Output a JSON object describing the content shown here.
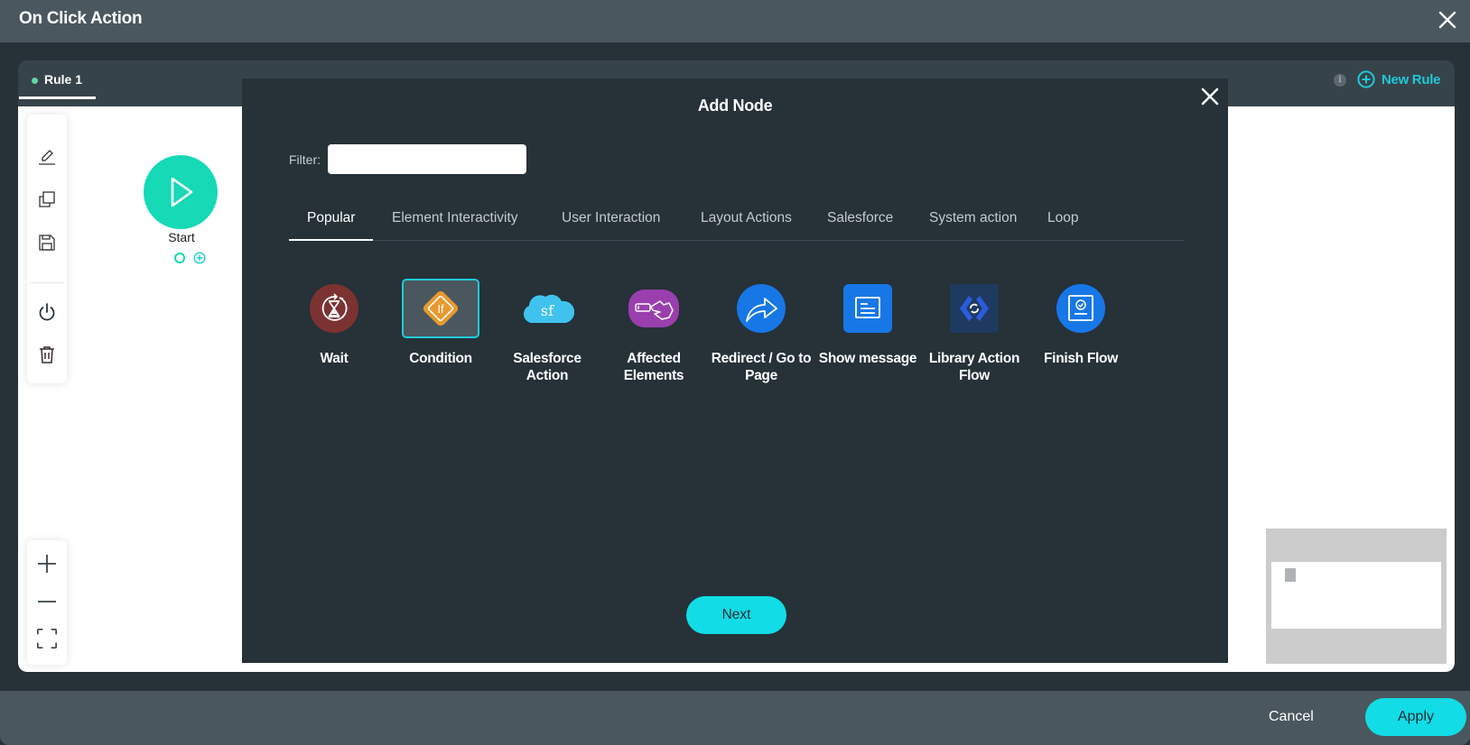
{
  "window": {
    "title": "On Click Action",
    "close_icon": "close-icon"
  },
  "rules": {
    "tabs": [
      {
        "label": "Rule 1",
        "status_color": "#5ed6a6",
        "active": true
      }
    ],
    "info_glyph": "i",
    "new_rule_label": "New Rule",
    "accent_color": "#1fc9d9"
  },
  "canvas": {
    "toolbar": [
      {
        "icon": "pencil-icon",
        "tooltip": ""
      },
      {
        "icon": "copy-icon"
      },
      {
        "icon": "save-icon"
      },
      {
        "icon": "power-icon"
      },
      {
        "icon": "trash-icon"
      }
    ],
    "zoom_controls": [
      "zoom-in-icon",
      "zoom-out-icon",
      "fit-screen-icon"
    ],
    "start_node": {
      "label": "Start",
      "color": "#16d9b6"
    }
  },
  "modal": {
    "title": "Add Node",
    "filter": {
      "label": "Filter:",
      "value": "",
      "placeholder": ""
    },
    "tabs": [
      {
        "label": "Popular",
        "active": true
      },
      {
        "label": "Element Interactivity"
      },
      {
        "label": "User Interaction"
      },
      {
        "label": "Layout Actions"
      },
      {
        "label": "Salesforce"
      },
      {
        "label": "System action"
      },
      {
        "label": "Loop"
      }
    ],
    "nodes": [
      {
        "label": "Wait",
        "icon": "hourglass-icon",
        "color": "#7d3232"
      },
      {
        "label": "Condition",
        "icon": "if-diamond-icon",
        "color": "#e8992f",
        "selected": true
      },
      {
        "label": "Salesforce Action",
        "icon": "salesforce-cloud-icon",
        "color": "#3fc3ee"
      },
      {
        "label": "Affected Elements",
        "icon": "hand-pointer-icon",
        "color": "#9a3fad"
      },
      {
        "label": "Redirect / Go to Page",
        "icon": "share-arrow-icon",
        "color": "#1877e6"
      },
      {
        "label": "Show message",
        "icon": "message-icon",
        "color": "#1877e6"
      },
      {
        "label": "Library Action Flow",
        "icon": "library-flow-icon",
        "color": "#1f3a5f"
      },
      {
        "label": "Finish Flow",
        "icon": "finish-flow-icon",
        "color": "#1877e6"
      }
    ],
    "next_label": "Next"
  },
  "footer": {
    "cancel_label": "Cancel",
    "apply_label": "Apply"
  }
}
